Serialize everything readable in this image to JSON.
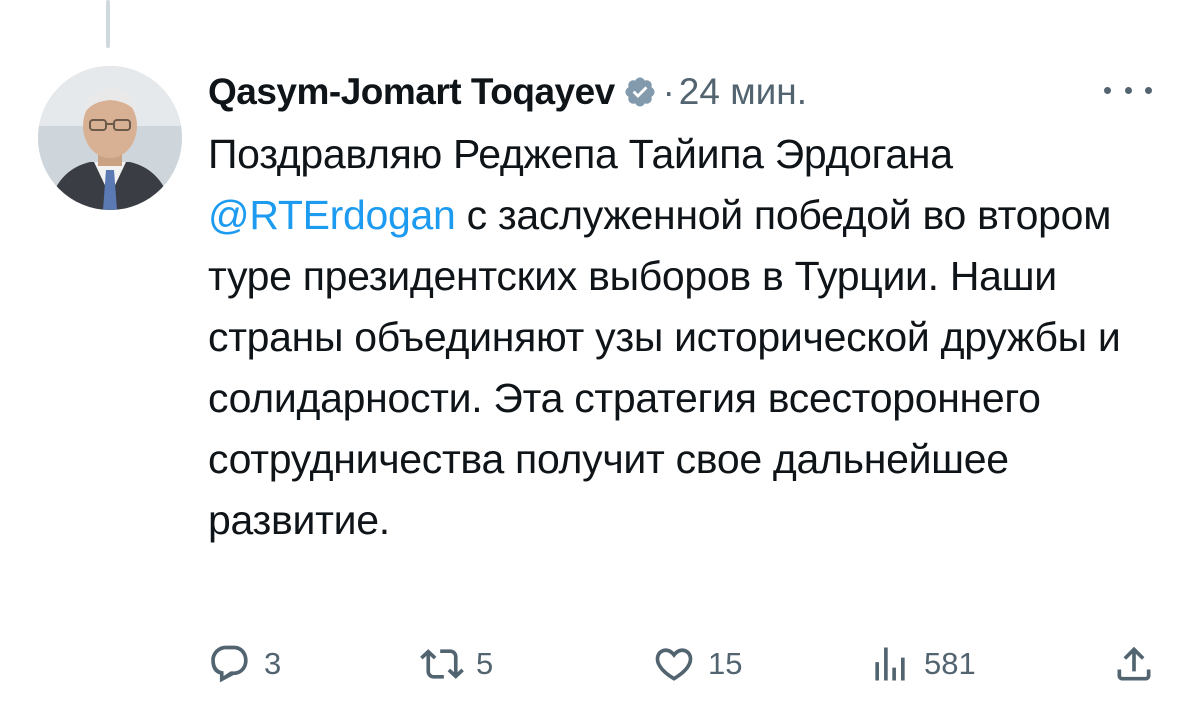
{
  "tweet": {
    "author_name": "Qasym-Jomart Toqayev",
    "separator": "·",
    "timestamp": "24 мин.",
    "text_before": "Поздравляю Реджепа Тайипа Эрдогана",
    "mention": "@RTErdogan",
    "text_after": " с заслуженной победой во втором туре президентских выборов в Турции. Наши страны объединяют узы исторической дружбы и солидарности. Эта стратегия всестороннего сотрудничества получит свое дальнейшее развитие."
  },
  "actions": {
    "replies": "3",
    "reposts": "5",
    "likes": "15",
    "views": "581"
  },
  "icons": {
    "verified": "verified-badge-icon",
    "more": "more-options-icon",
    "reply": "reply-icon",
    "repost": "repost-icon",
    "like": "heart-icon",
    "views": "views-icon",
    "share": "share-icon"
  },
  "colors": {
    "accent": "#1d9bf0",
    "muted": "#536471",
    "text": "#0f1419",
    "verified_badge": "#829aab"
  }
}
